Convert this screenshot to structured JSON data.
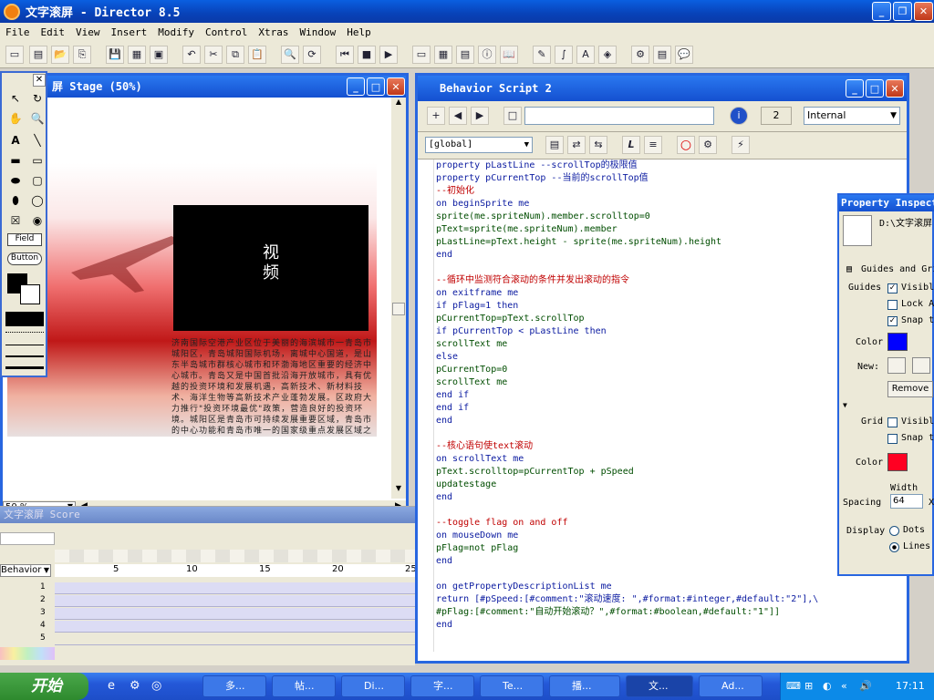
{
  "window": {
    "title": "文字滚屏 - Director 8.5"
  },
  "menu": [
    "File",
    "Edit",
    "View",
    "Insert",
    "Modify",
    "Control",
    "Xtras",
    "Window",
    "Help"
  ],
  "stage": {
    "title": "屏 Stage (50%)",
    "video_label": "视\n频",
    "zoom": "50 %",
    "body_text": "济南国际空港产业区位于美丽的海滨城市一青岛市城阳区，青岛城阳国际机场，离城中心国道，是山东半岛城市群核心城市和环渤海地区重要的经济中心城市。青岛又是中国首批沿海开放城市，具有优越的投资环境和发展机遇，高新技术、新材料技术、海洋生物等高新技术产业蓬勃发展。区政府大力推行\"投资环境最优\"政策，营造良好的投资环境。城阳区是青岛市可持续发展重要区域，青岛市的中心功能和青岛市唯一的国家级重点发展区域之一，一级金融安全区。"
  },
  "score": {
    "title": "文字滚屏 Score",
    "dropdown": "Behavior",
    "frames": [
      "5",
      "10",
      "15",
      "20",
      "25"
    ],
    "channels": [
      "1",
      "2",
      "3",
      "4",
      "5"
    ]
  },
  "script": {
    "title": "Behavior Script 2",
    "name_value": "",
    "number": "2",
    "type": "Internal",
    "scope": "[global]",
    "lines": [
      "property pLastLine --scrollTop的极限值",
      "property pCurrentTop --当前的scrollTop值",
      "--初始化",
      "on beginSprite me",
      "sprite(me.spriteNum).member.scrolltop=0",
      "pText=sprite(me.spriteNum).member",
      "pLastLine=pText.height - sprite(me.spriteNum).height",
      "end",
      "",
      "--循环中监测符合滚动的条件并发出滚动的指令",
      "on exitframe me",
      "if pFlag=1 then",
      "pCurrentTop=pText.scrollTop",
      "if pCurrentTop < pLastLine then",
      "scrollText me",
      "else",
      "pCurrentTop=0",
      "scrollText me",
      "end if",
      "end if",
      "end",
      "",
      "--核心语句使text滚动",
      "on scrollText me",
      "pText.scrolltop=pCurrentTop + pSpeed",
      "updatestage",
      "end",
      "",
      "--toggle flag on and off",
      "on mouseDown me",
      "pFlag=not pFlag",
      "end",
      "",
      "on getPropertyDescriptionList me",
      "return [#pSpeed:[#comment:\"滚动速度: \",#format:#integer,#default:\"2\"],\\",
      "#pFlag:[#comment:\"自动开始滚动？\",#format:#boolean,#default:\"1\"]]",
      "end"
    ]
  },
  "property": {
    "title": "Property Inspector",
    "path": "D:\\文字滚屏",
    "section": "Guides and Grid",
    "guides_label": "Guides",
    "visible": "Visible",
    "lock": "Lock All",
    "snap": "Snap to",
    "color_label": "Color",
    "new_label": "New:",
    "remove": "Remove",
    "grid_label": "Grid",
    "grid_visible": "Visible",
    "grid_snap": "Snap to",
    "width_label": "Width",
    "spacing_label": "Spacing",
    "spacing_value": "64",
    "x_label": "X",
    "display_label": "Display",
    "dots": "Dots",
    "lines": "Lines",
    "guide_color": "#0000ff",
    "grid_color": "#ff0022"
  },
  "taskbar": {
    "start": "开始",
    "tasks": [
      "多...",
      "帖...",
      "Di...",
      "字...",
      "Te...",
      "播...",
      "文...",
      "Ad..."
    ],
    "clock": "17:11"
  }
}
